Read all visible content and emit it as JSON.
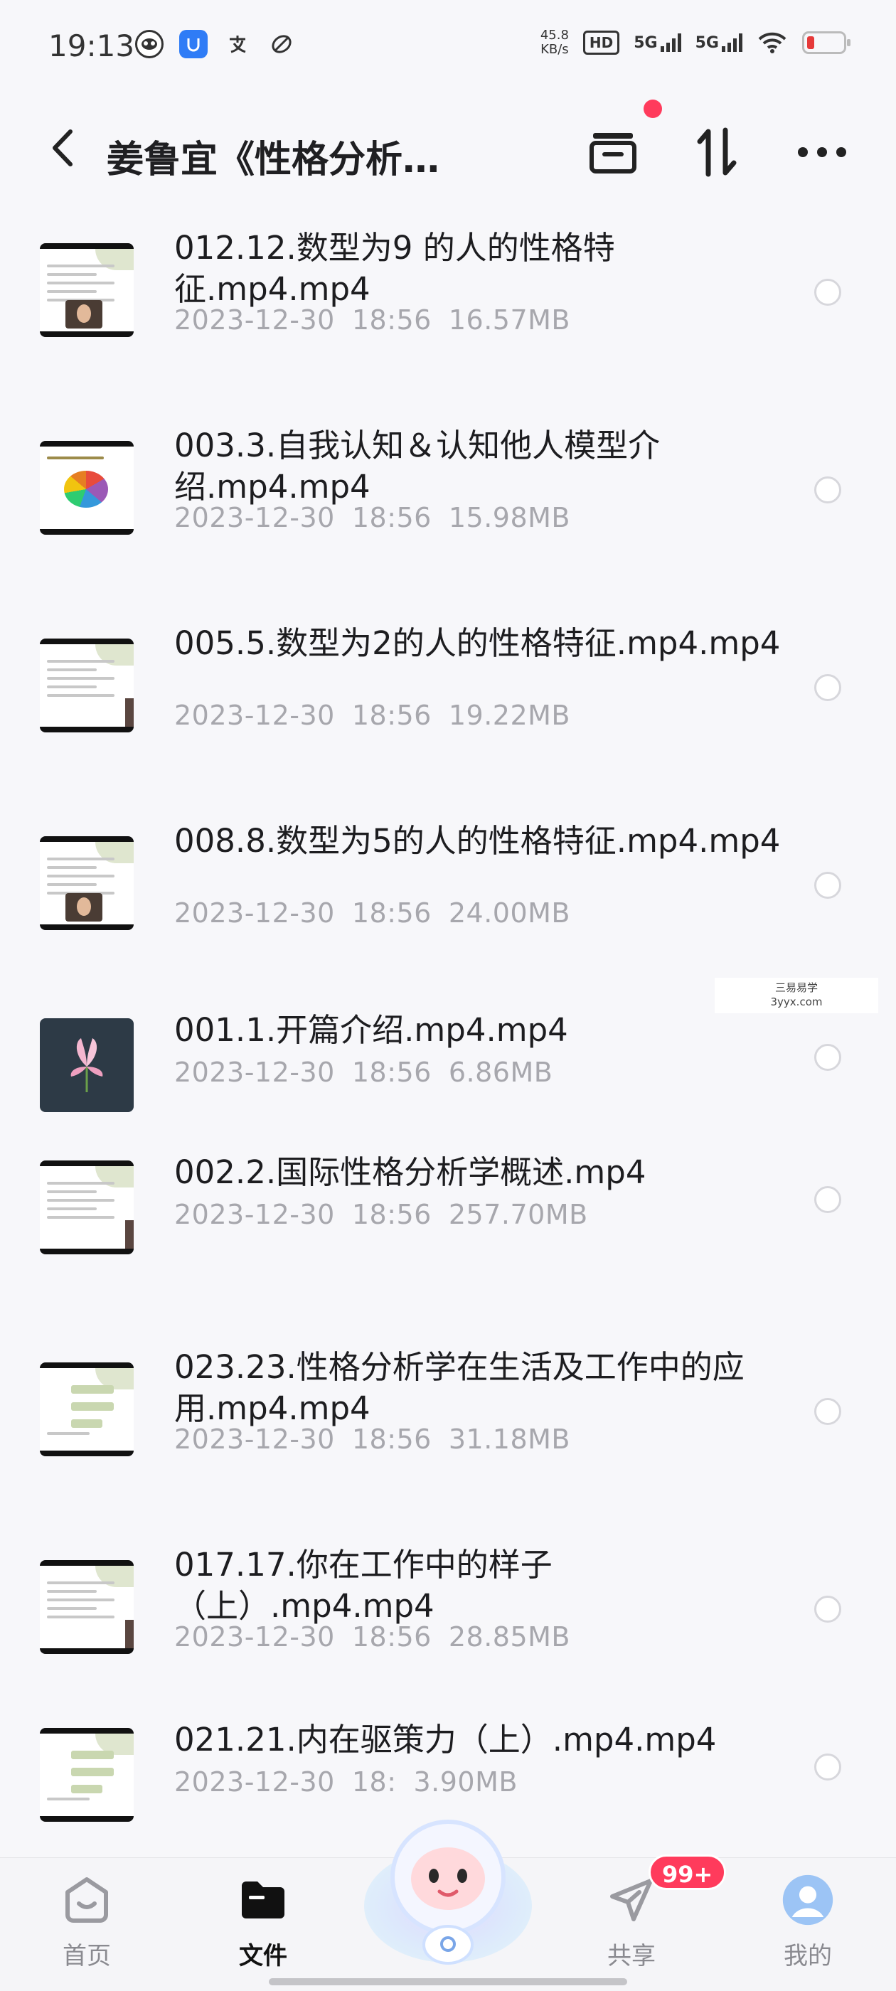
{
  "status_bar": {
    "time": "19:13",
    "speed_value": "45.8",
    "speed_unit": "KB/s",
    "hd_label": "HD",
    "net1": "5G",
    "net2": "5G"
  },
  "header": {
    "title": "姜鲁宜《性格分析…"
  },
  "files": [
    {
      "name": "012.12.数型为9 的人的性格特征.mp4.mp4",
      "date": "2023-12-30",
      "time": "18:56",
      "size": "16.57MB",
      "thumb": "light-face"
    },
    {
      "name": "003.3.自我认知＆认知他人模型介绍.mp4.mp4",
      "date": "2023-12-30",
      "time": "18:56",
      "size": "15.98MB",
      "thumb": "pie"
    },
    {
      "name": "005.5.数型为2的人的性格特征.mp4.mp4",
      "date": "2023-12-30",
      "time": "18:56",
      "size": "19.22MB",
      "thumb": "light-text"
    },
    {
      "name": "008.8.数型为5的人的性格特征.mp4.mp4",
      "date": "2023-12-30",
      "time": "18:56",
      "size": "24.00MB",
      "thumb": "light-face"
    },
    {
      "name": "001.1.开篇介绍.mp4.mp4",
      "date": "2023-12-30",
      "time": "18:56",
      "size": "6.86MB",
      "thumb": "flower"
    },
    {
      "name": "002.2.国际性格分析学概述.mp4",
      "date": "2023-12-30",
      "time": "18:56",
      "size": "257.70MB",
      "thumb": "light-text"
    },
    {
      "name": "023.23.性格分析学在生活及工作中的应用.mp4.mp4",
      "date": "2023-12-30",
      "time": "18:56",
      "size": "31.18MB",
      "thumb": "green"
    },
    {
      "name": "017.17.你在工作中的样子（上）.mp4.mp4",
      "date": "2023-12-30",
      "time": "18:56",
      "size": "28.85MB",
      "thumb": "light-text"
    },
    {
      "name": "021.21.内在驱策力（上）.mp4.mp4",
      "date": "2023-12-30",
      "time": "18:",
      "size": "3.90MB",
      "thumb": "green"
    }
  ],
  "watermark": {
    "line1": "三易易学",
    "line2": "3yyx.com"
  },
  "bottom_nav": {
    "tabs": [
      {
        "label": "首页",
        "icon": "home-icon"
      },
      {
        "label": "文件",
        "icon": "folder-icon"
      },
      {
        "label": "共享",
        "icon": "send-icon"
      },
      {
        "label": "我的",
        "icon": "profile-icon"
      }
    ],
    "share_badge": "99+",
    "active_tab": "文件"
  },
  "colors": {
    "background": "#f7f7fa",
    "accent_red": "#ff3b5c",
    "meta_gray": "#a7a7ad"
  }
}
